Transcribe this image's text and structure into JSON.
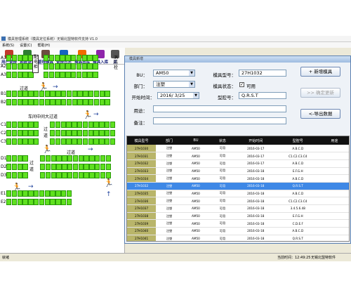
{
  "window": {
    "title": "模具管理系统（模具定位系统）无锡北盟特软件支持 V1.0"
  },
  "menu": [
    "系统(S)",
    "设置(C)",
    "帮助(H)"
  ],
  "toolbar": [
    {
      "label": "用户管理",
      "icon": "users-icon",
      "color": "#c0392b"
    },
    {
      "label": "系统设置",
      "icon": "settings-icon",
      "color": "#2e7d32"
    },
    {
      "label": "管理模具",
      "icon": "mold-icon",
      "color": "#6d4c41"
    },
    {
      "label": "管理日志",
      "icon": "log-icon",
      "color": "#1565c0"
    },
    {
      "label": "模具出库",
      "icon": "stock-out-icon",
      "color": "#ef6c00"
    },
    {
      "label": "模具入库",
      "icon": "stock-in-icon",
      "color": "#8e24aa"
    },
    {
      "label": "关",
      "icon": "close-icon",
      "color": "#555555"
    }
  ],
  "map": {
    "rows": [
      "A1",
      "A2",
      "A3",
      "B1",
      "B2",
      "C1",
      "C2",
      "C3",
      "D1",
      "D2",
      "D3",
      "E1",
      "E2"
    ],
    "texts": {
      "electric_box": "配电柜",
      "fire_box": "消防栓",
      "aisle": "过道",
      "workshop_aisle": "车间中间大过道"
    },
    "cell_color": "#5fe11f"
  },
  "dialog": {
    "title": "模具新增",
    "fields": {
      "bu_label": "BU：",
      "bu_value": "AM50",
      "mold_no_label": "模具型号：",
      "mold_no_value": "27H1032",
      "dept_label": "部门：",
      "dept_value": "注塑",
      "status_label": "模具状态：",
      "status_check": "可用",
      "start_label": "开始时间：",
      "start_value": "2016/ 3/25",
      "model_label": "型腔号：",
      "model_value": "Q.R.S.T",
      "use_label": "用途：",
      "use_value": "",
      "note_label": "备注：",
      "note_value": ""
    },
    "buttons": {
      "add": "+ 新增模具",
      "confirm": ">> 确定更新",
      "export": "<-导出数据"
    },
    "table": {
      "headers": [
        "模具型号",
        "部门",
        "BU",
        "状态",
        "开始时间",
        "型腔号",
        "用途"
      ],
      "rows": [
        [
          "27H1030",
          "注塑",
          "AM50",
          "可用",
          "2016-03-17",
          "A.B.C.D",
          ""
        ],
        [
          "27H1031",
          "注塑",
          "AM50",
          "可用",
          "2016-03-17",
          "C1.C2.C3.C4",
          ""
        ],
        [
          "27H1032",
          "注塑",
          "AM50",
          "可用",
          "2016-03-17",
          "A.B.C.D",
          ""
        ],
        [
          "27H1033",
          "注塑",
          "AM50",
          "可用",
          "2016-03-18",
          "E.F.G.H",
          ""
        ],
        [
          "27H1034",
          "注塑",
          "AM50",
          "可用",
          "2016-03-18",
          "A.B.C.D",
          ""
        ],
        [
          "27H1032",
          "注塑",
          "AM50",
          "可用",
          "2016-03-18",
          "Q.R.S.T",
          ""
        ],
        [
          "27H1035",
          "注塑",
          "AM50",
          "可用",
          "2016-03-18",
          "A.B.C.D",
          ""
        ],
        [
          "27H1036",
          "注塑",
          "AM50",
          "可用",
          "2016-03-18",
          "C1.C2.C3.C4",
          ""
        ],
        [
          "27H1037",
          "注塑",
          "AM50",
          "可用",
          "2016-03-18",
          "3.4.5.6.48",
          ""
        ],
        [
          "27H1038",
          "注塑",
          "AM50",
          "可用",
          "2016-03-18",
          "E.F.G.H",
          ""
        ],
        [
          "27H1039",
          "注塑",
          "AM50",
          "可用",
          "2016-03-18",
          "C.D.E.F",
          ""
        ],
        [
          "27H1040",
          "注塑",
          "AM50",
          "可用",
          "2016-03-18",
          "A.B.C.D",
          ""
        ],
        [
          "27H1041",
          "注塑",
          "AM50",
          "可用",
          "2016-03-18",
          "Q.R.S.T",
          ""
        ]
      ],
      "selected_row": 5
    }
  },
  "statusbar": {
    "left": "就绪",
    "time_label": "当前时间：12:49:25",
    "company": "无锡北盟特软件"
  }
}
